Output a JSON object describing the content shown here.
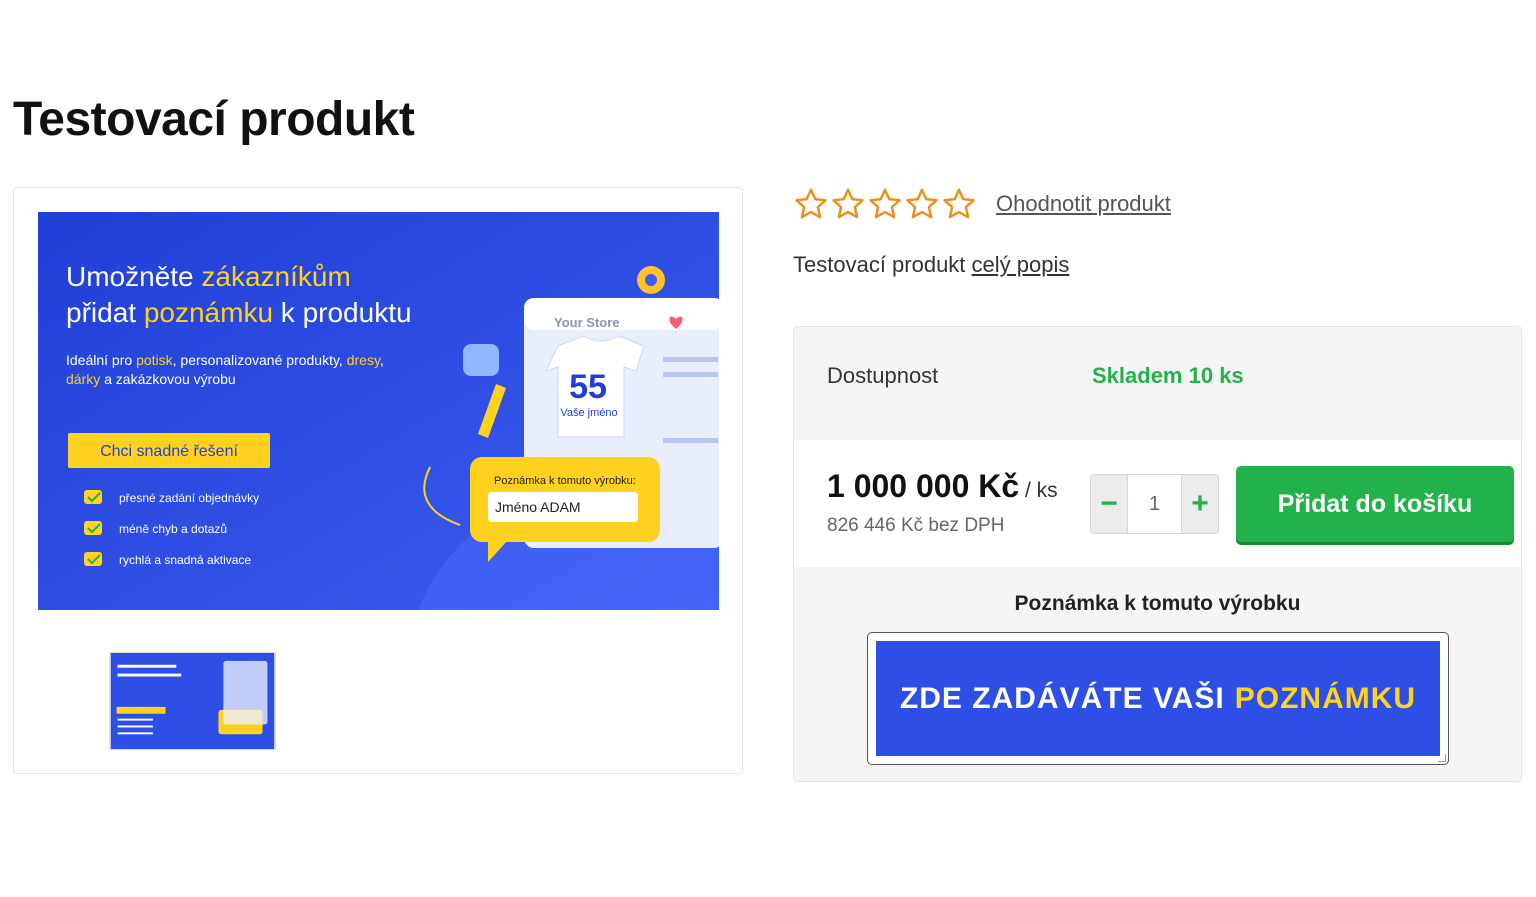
{
  "page": {
    "title": "Testovací produkt"
  },
  "gallery": {
    "banner": {
      "headline_part1": "Umožněte ",
      "headline_hl1": "zákazníkům",
      "headline_part2": "přidat ",
      "headline_hl2": "poznámku",
      "headline_part3": " k produktu",
      "sub_part1": "Ideální pro ",
      "sub_hl1": "potisk",
      "sub_part2": ", personalizované produkty, ",
      "sub_hl2": "dresy",
      "sub_part3": ",",
      "sub_hl3": "dárky",
      "sub_part4": " a zakázkovou výrobu",
      "cta_label": "Chci snadné řešení",
      "benefits": [
        "přesné zadání objednávky",
        "méně chyb a dotazů",
        "rychlá a snadná aktivace"
      ],
      "store_label": "Your Store",
      "shirt_number": "55",
      "shirt_name": "Vaše jméno",
      "note_bubble_title": "Poznámka k tomuto výrobku:",
      "note_bubble_value": "Jméno ADAM"
    }
  },
  "rating": {
    "stars_filled": 0,
    "stars_total": 5,
    "rate_link": "Ohodnotit produkt"
  },
  "short_description": {
    "text": "Testovací produkt ",
    "link": "celý popis"
  },
  "buy_box": {
    "availability_label": "Dostupnost",
    "availability_value": "Skladem 10 ks",
    "price": "1 000 000 Kč",
    "price_unit": " / ks",
    "price_without_vat": "826 446 Kč bez DPH",
    "quantity": "1",
    "minus": "−",
    "plus": "+",
    "add_to_cart": "Přidat do košíku",
    "note_label": "Poznámka k tomuto výrobku",
    "note_text_part1": "ZDE ZADÁVÁTE VAŠI",
    "note_text_highlight": "POZNÁMKU"
  },
  "colors": {
    "accent_green": "#21b34a",
    "banner_blue": "#2d4fe6",
    "highlight_yellow": "#ffd21f",
    "star_orange": "#f08c1a"
  }
}
